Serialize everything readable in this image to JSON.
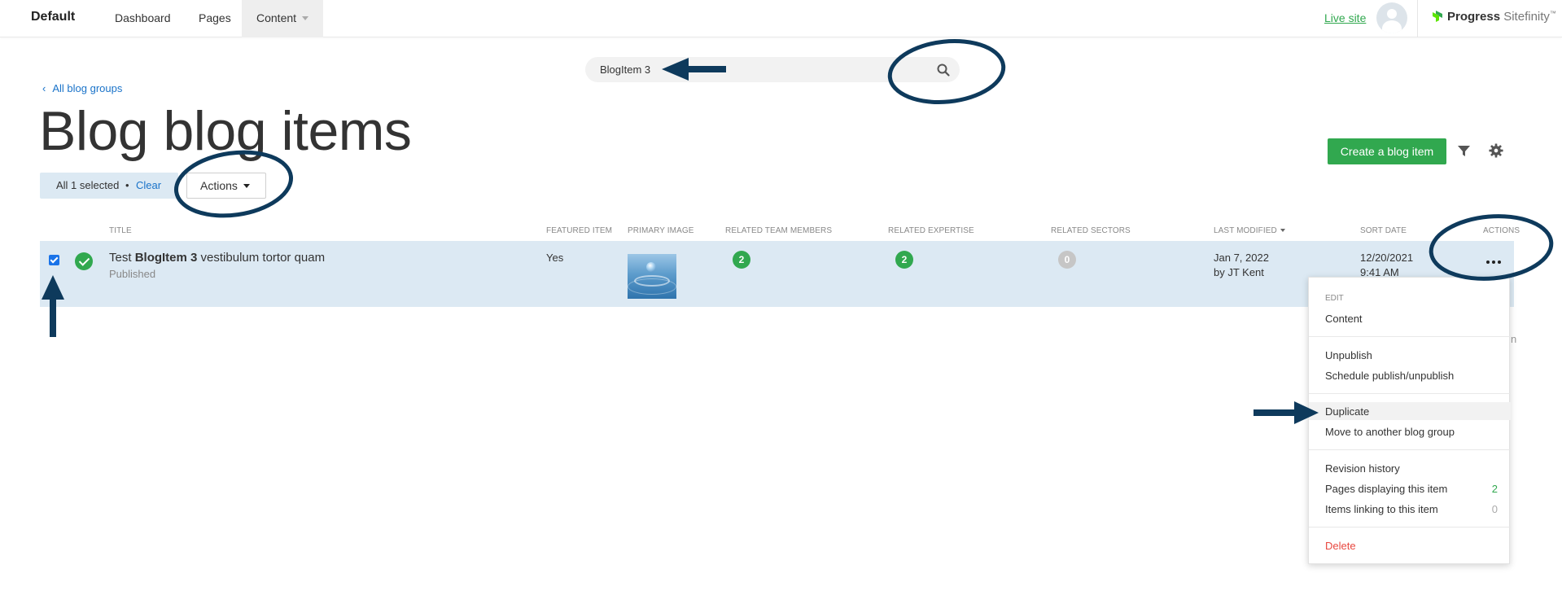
{
  "topnav": {
    "site_name": "Default",
    "items": [
      "Dashboard",
      "Pages",
      "Content"
    ],
    "live_site": "Live site",
    "logo_brand": "Progress",
    "logo_product": "Sitefinity",
    "logo_mark": "™"
  },
  "search": {
    "value": "BlogItem 3",
    "icon": "search-icon"
  },
  "back_link": "All blog groups",
  "page_title": "Blog blog items",
  "toolbar": {
    "create_label": "Create a blog item",
    "selection_text": "All 1 selected",
    "dot": "•",
    "clear_label": "Clear",
    "actions_label": "Actions"
  },
  "table": {
    "headers": {
      "title": "TITLE",
      "featured": "FEATURED ITEM",
      "image": "PRIMARY IMAGE",
      "team": "RELATED TEAM MEMBERS",
      "expertise": "RELATED EXPERTISE",
      "sectors": "RELATED SECTORS",
      "modified": "LAST MODIFIED",
      "sortdate": "SORT DATE",
      "actions": "ACTIONS"
    },
    "row": {
      "title_prefix": "Test ",
      "title_bold": "BlogItem 3",
      "title_suffix": " vestibulum tortor quam",
      "status": "Published",
      "featured": "Yes",
      "team_count": "2",
      "expertise_count": "2",
      "sectors_count": "0",
      "modified_date": "Jan 7, 2022",
      "modified_by": "by JT Kent",
      "sort_date": "12/20/2021",
      "sort_time": "9:41 AM"
    }
  },
  "menu": {
    "edit_title": "EDIT",
    "content": "Content",
    "unpublish": "Unpublish",
    "schedule": "Schedule publish/unpublish",
    "duplicate": "Duplicate",
    "move": "Move to another blog group",
    "revision": "Revision history",
    "pages_displaying": "Pages displaying this item",
    "pages_displaying_count": "2",
    "items_linking": "Items linking to this item",
    "items_linking_count": "0",
    "delete": "Delete"
  },
  "partial_text": "n",
  "colors": {
    "accent_green": "#31a84f",
    "link_blue": "#1a73c9",
    "selected_row": "#dce9f3",
    "annotation": "#0e3a5c",
    "delete_red": "#e8473f"
  }
}
